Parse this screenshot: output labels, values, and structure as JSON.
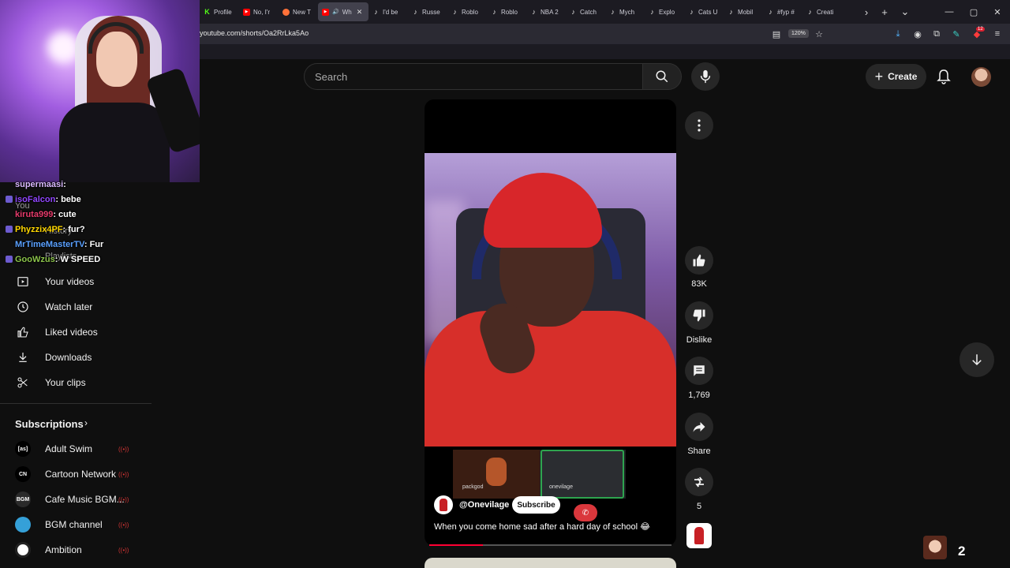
{
  "browser": {
    "tabs": [
      {
        "label": "Profile",
        "fav": "K",
        "color": "#53fc18"
      },
      {
        "label": "No, I'r",
        "fav": "yt",
        "color": "#ff0000"
      },
      {
        "label": "New T",
        "fav": "ff",
        "color": "#ff7139"
      },
      {
        "label": "Wh",
        "fav": "yt",
        "color": "#ff0000",
        "active": true
      },
      {
        "label": "I'd be",
        "fav": "tt"
      },
      {
        "label": "Russe",
        "fav": "tt"
      },
      {
        "label": "Roblo",
        "fav": "tt"
      },
      {
        "label": "Roblo",
        "fav": "tt"
      },
      {
        "label": "NBA 2",
        "fav": "tt"
      },
      {
        "label": "Catch",
        "fav": "tt"
      },
      {
        "label": "Mych",
        "fav": "tt"
      },
      {
        "label": "Explo",
        "fav": "tt"
      },
      {
        "label": "Cats U",
        "fav": "tt"
      },
      {
        "label": "Mobil",
        "fav": "tt"
      },
      {
        "label": "#fyp #",
        "fav": "tt"
      },
      {
        "label": "Creati",
        "fav": "tt"
      }
    ],
    "url": "youtube.com/shorts/Oa2RrLka5Ao",
    "zoom": "120%",
    "ext_badge": "12"
  },
  "header": {
    "search_placeholder": "Search",
    "create_label": "Create"
  },
  "sidebar": {
    "ghost_you": "You",
    "ghost_history": "History",
    "ghost_playlists": "Playlists",
    "items": [
      {
        "label": "Your videos",
        "icon": "your-videos-icon"
      },
      {
        "label": "Watch later",
        "icon": "clock-icon"
      },
      {
        "label": "Liked videos",
        "icon": "thumbs-up-icon"
      },
      {
        "label": "Downloads",
        "icon": "download-icon"
      },
      {
        "label": "Your clips",
        "icon": "scissors-icon"
      }
    ],
    "subscriptions_title": "Subscriptions",
    "channels": [
      {
        "label": "Adult Swim",
        "short": "[as]",
        "bg": "#000000"
      },
      {
        "label": "Cartoon Network",
        "short": "CN",
        "bg": "#000000"
      },
      {
        "label": "Cafe Music BGM...",
        "short": "BGM",
        "bg": "#2a2a2a"
      },
      {
        "label": "BGM channel",
        "short": "",
        "bg": "#35a0d8"
      },
      {
        "label": "Ambition",
        "short": "",
        "bg": "#ffffff"
      }
    ]
  },
  "chat": [
    {
      "user": "supermaasi",
      "msg": "",
      "color": "#d9b8ff"
    },
    {
      "user": "isoFalcon",
      "msg": "bebe",
      "color": "#9146ff"
    },
    {
      "user": "kiruta999",
      "msg": "cute",
      "color": "#e63b6b"
    },
    {
      "user": "Phyzzix4PF",
      "msg": "fur?",
      "color": "#ffd700"
    },
    {
      "user": "MrTimeMasterTV",
      "msg": "Fur",
      "color": "#5aa0ff"
    },
    {
      "user": "GooWzus",
      "msg": "W SPEED",
      "color": "#8bc34a"
    }
  ],
  "short": {
    "channel": "@Onevilage",
    "subscribe_label": "Subscribe",
    "caption": "When you come home sad after a hard day of school 😂",
    "call_tile_1": "packgod",
    "call_tile_2": "onevilage",
    "progress": 0.22
  },
  "actions": {
    "likes": "83K",
    "dislike_label": "Dislike",
    "comments": "1,769",
    "share_label": "Share",
    "remix_count": "5"
  },
  "viewer_count": "2"
}
